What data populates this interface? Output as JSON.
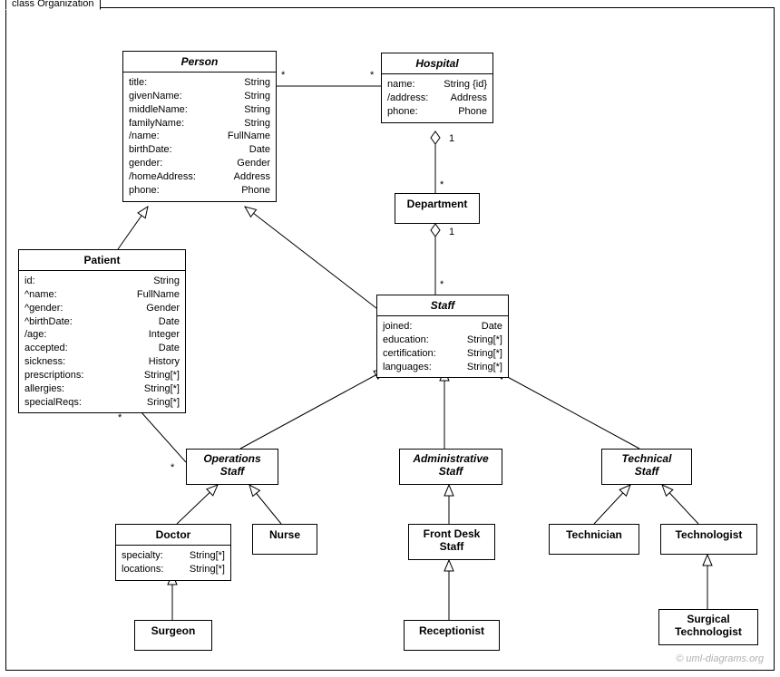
{
  "frame": {
    "title": "class Organization"
  },
  "classes": {
    "person": {
      "name": "Person",
      "attrs": [
        [
          "title:",
          "String"
        ],
        [
          "givenName:",
          "String"
        ],
        [
          "middleName:",
          "String"
        ],
        [
          "familyName:",
          "String"
        ],
        [
          "/name:",
          "FullName"
        ],
        [
          "birthDate:",
          "Date"
        ],
        [
          "gender:",
          "Gender"
        ],
        [
          "/homeAddress:",
          "Address"
        ],
        [
          "phone:",
          "Phone"
        ]
      ]
    },
    "hospital": {
      "name": "Hospital",
      "attrs": [
        [
          "name:",
          "String {id}"
        ],
        [
          "/address:",
          "Address"
        ],
        [
          "phone:",
          "Phone"
        ]
      ]
    },
    "department": {
      "name": "Department"
    },
    "patient": {
      "name": "Patient",
      "attrs": [
        [
          "id:",
          "String"
        ],
        [
          "^name:",
          "FullName"
        ],
        [
          "^gender:",
          "Gender"
        ],
        [
          "^birthDate:",
          "Date"
        ],
        [
          "/age:",
          "Integer"
        ],
        [
          "accepted:",
          "Date"
        ],
        [
          "sickness:",
          "History"
        ],
        [
          "prescriptions:",
          "String[*]"
        ],
        [
          "allergies:",
          "String[*]"
        ],
        [
          "specialReqs:",
          "Sring[*]"
        ]
      ]
    },
    "staff": {
      "name": "Staff",
      "attrs": [
        [
          "joined:",
          "Date"
        ],
        [
          "education:",
          "String[*]"
        ],
        [
          "certification:",
          "String[*]"
        ],
        [
          "languages:",
          "String[*]"
        ]
      ]
    },
    "operations_staff": {
      "name": "Operations\nStaff"
    },
    "administrative_staff": {
      "name": "Administrative\nStaff"
    },
    "technical_staff": {
      "name": "Technical\nStaff"
    },
    "doctor": {
      "name": "Doctor",
      "attrs": [
        [
          "specialty:",
          "String[*]"
        ],
        [
          "locations:",
          "String[*]"
        ]
      ]
    },
    "nurse": {
      "name": "Nurse"
    },
    "front_desk_staff": {
      "name": "Front Desk\nStaff"
    },
    "receptionist": {
      "name": "Receptionist"
    },
    "technician": {
      "name": "Technician"
    },
    "technologist": {
      "name": "Technologist"
    },
    "surgical_technologist": {
      "name": "Surgical\nTechnologist"
    },
    "surgeon": {
      "name": "Surgeon"
    }
  },
  "mult": {
    "star1": "*",
    "star2": "*",
    "star3": "*",
    "star4": "*",
    "star5": "*",
    "star6": "*",
    "one1": "1",
    "one2": "1"
  },
  "watermark": "© uml-diagrams.org"
}
